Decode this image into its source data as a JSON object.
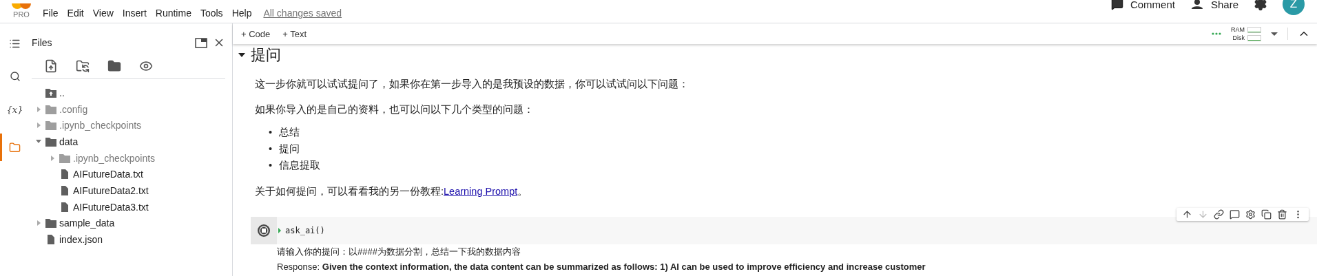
{
  "header": {
    "logo_badge": "PRO",
    "menu": [
      {
        "label": "File"
      },
      {
        "label": "Edit"
      },
      {
        "label": "View"
      },
      {
        "label": "Insert"
      },
      {
        "label": "Runtime"
      },
      {
        "label": "Tools"
      },
      {
        "label": "Help"
      }
    ],
    "save_status": "All changes saved",
    "comment_button": "Comment",
    "share_button": "Share",
    "avatar": "Z"
  },
  "rail": [
    {
      "kind": "toc",
      "selected": false
    },
    {
      "kind": "search",
      "selected": false
    },
    {
      "kind": "variables",
      "label": "{x}",
      "selected": false
    },
    {
      "kind": "files",
      "selected": true
    }
  ],
  "files_panel": {
    "title": "Files",
    "tree": [
      {
        "kind": "parent",
        "name": ".."
      },
      {
        "kind": "folder",
        "name": ".config",
        "hidden": true,
        "expanded": false
      },
      {
        "kind": "folder",
        "name": ".ipynb_checkpoints",
        "hidden": true,
        "expanded": false
      },
      {
        "kind": "folder",
        "name": "data",
        "hidden": false,
        "expanded": true,
        "children": [
          {
            "kind": "folder",
            "name": ".ipynb_checkpoints",
            "hidden": true,
            "expanded": false
          },
          {
            "kind": "file",
            "name": "AIFutureData.txt"
          },
          {
            "kind": "file",
            "name": "AIFutureData2.txt"
          },
          {
            "kind": "file",
            "name": "AIFutureData3.txt"
          }
        ]
      },
      {
        "kind": "folder",
        "name": "sample_data",
        "hidden": false,
        "expanded": false
      },
      {
        "kind": "file",
        "name": "index.json"
      }
    ]
  },
  "toolbar": {
    "add_code": "+ Code",
    "add_text": "+ Text",
    "resources": [
      {
        "label": "RAM"
      },
      {
        "label": "Disk"
      }
    ]
  },
  "section": {
    "title": "提问",
    "expanded": true,
    "paragraphs": [
      "这一步你就可以试试提问了，如果你在第一步导入的是我预设的数据，你可以试试问以下问题：",
      "如果你导入的是自己的资料，也可以问以下几个类型的问题："
    ],
    "bullets": [
      {
        "marker": "•",
        "text": "总结"
      },
      {
        "marker": "•",
        "text": "提问"
      },
      {
        "marker": "•",
        "text": "信息提取"
      }
    ],
    "closing_text": "关于如何提问，可以看看我的另一份教程:",
    "closing_link": "Learning Prompt",
    "closing_end": "。"
  },
  "cell_toolbar": [
    {
      "kind": "up",
      "disabled": false
    },
    {
      "kind": "down",
      "disabled": true
    },
    {
      "kind": "link",
      "disabled": false
    },
    {
      "kind": "comment",
      "disabled": false
    },
    {
      "kind": "settings",
      "disabled": false
    },
    {
      "kind": "mirror",
      "disabled": false
    },
    {
      "kind": "delete",
      "disabled": false
    },
    {
      "kind": "more",
      "disabled": false
    }
  ],
  "code_cell": {
    "running": true,
    "code": "ask_ai()",
    "output": [
      "请输入你的提问：以####为数据分割，总结一下我的数据内容",
      "Response: **Given the context information, the data content can be summarized as follows: 1) AI can be used to improve efficiency and increase customer**"
    ]
  }
}
